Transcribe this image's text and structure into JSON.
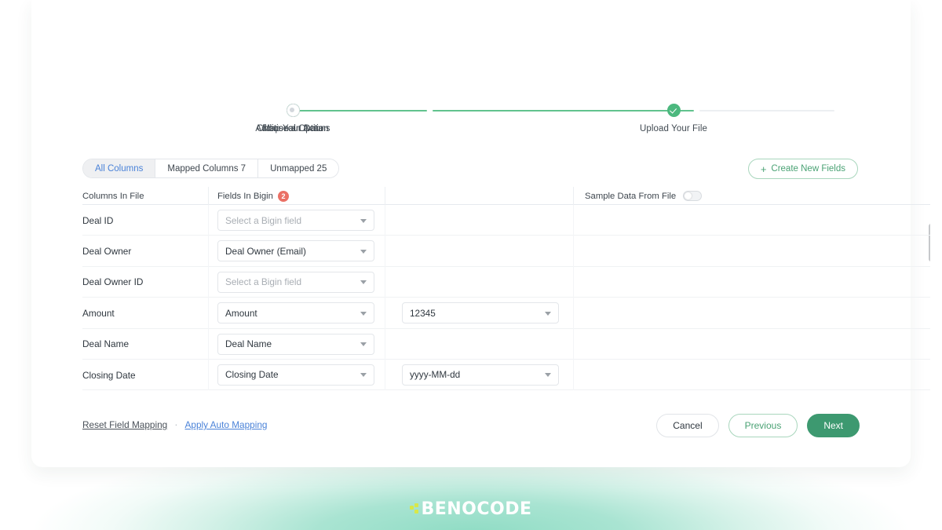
{
  "stepper": {
    "steps": [
      {
        "label": "Upload Your File",
        "state": "done"
      },
      {
        "label": "Choose an Action",
        "state": "done"
      },
      {
        "label": "Map Your Data",
        "state": "active"
      },
      {
        "label": "Additional Options",
        "state": "pending"
      }
    ]
  },
  "tabs": [
    {
      "label": "All Columns",
      "active": true
    },
    {
      "label": "Mapped Columns 7",
      "active": false
    },
    {
      "label": "Unmapped 25",
      "active": false
    }
  ],
  "toolbar": {
    "create_fields_label": "Create New Fields",
    "plus_icon": "plus-icon"
  },
  "table": {
    "headers": {
      "columns_in_file": "Columns In File",
      "fields_in_bigin": "Fields In Bigin",
      "fields_in_bigin_badge": "2",
      "sample_data_from_file": "Sample Data From File"
    },
    "rows": [
      {
        "name": "Deal ID",
        "field": "Select a Bigin field",
        "field_placeholder": true,
        "format": null
      },
      {
        "name": "Deal Owner",
        "field": "Deal Owner (Email)",
        "field_placeholder": false,
        "format": null
      },
      {
        "name": "Deal Owner ID",
        "field": "Select a Bigin field",
        "field_placeholder": true,
        "format": null
      },
      {
        "name": "Amount",
        "field": "Amount",
        "field_placeholder": false,
        "format": "12345"
      },
      {
        "name": "Deal Name",
        "field": "Deal Name",
        "field_placeholder": false,
        "format": null
      },
      {
        "name": "Closing Date",
        "field": "Closing Date",
        "field_placeholder": false,
        "format": "yyyy-MM-dd"
      }
    ]
  },
  "footer": {
    "reset_label": "Reset Field Mapping",
    "separator": "·",
    "auto_map_label": "Apply Auto Mapping",
    "cancel_label": "Cancel",
    "previous_label": "Previous",
    "next_label": "Next"
  },
  "branding": {
    "watermark": "BENOCODE"
  },
  "colors": {
    "accent_green": "#3d9970",
    "step_green": "#4cb87e",
    "link_blue": "#4a82d8",
    "badge_red": "#ea7065"
  }
}
